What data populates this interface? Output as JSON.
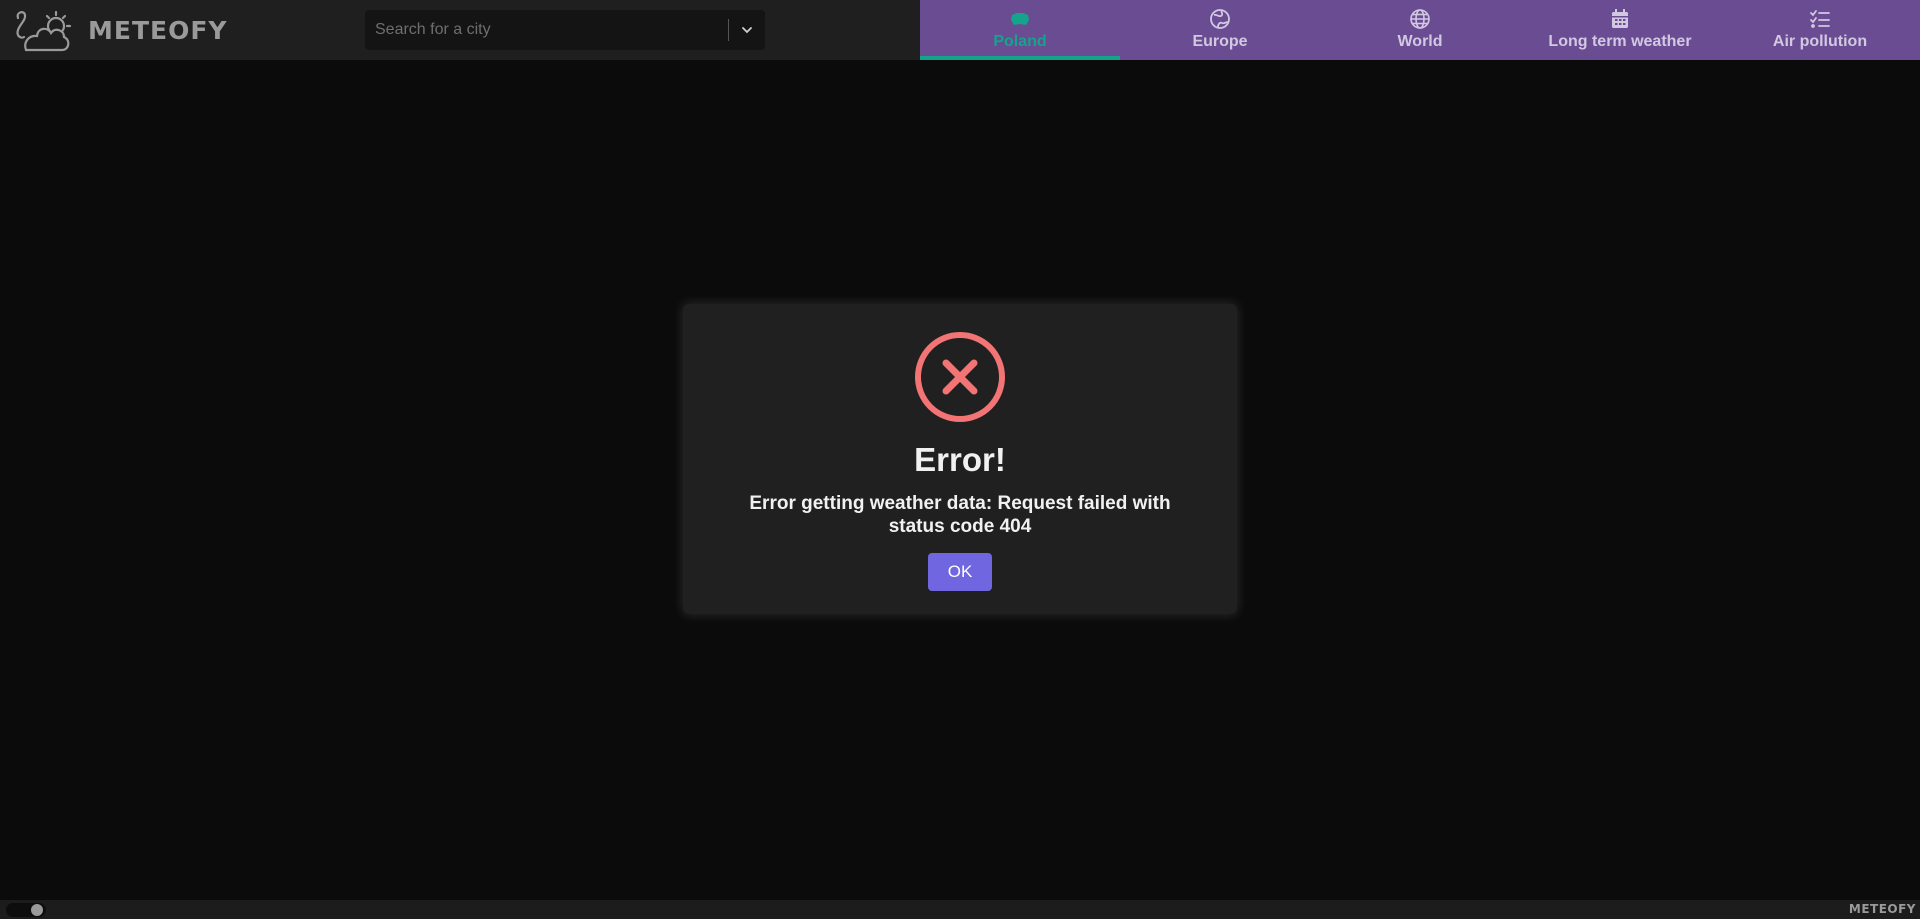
{
  "app": {
    "logo_text": "METEOFY",
    "logo_icon": "cloud-sun-icon"
  },
  "search": {
    "placeholder": "Search for a city",
    "value": "",
    "dropdown_icon": "chevron-down-icon"
  },
  "nav": {
    "tabs": [
      {
        "label": "Poland",
        "icon": "poland-map-icon",
        "active": true
      },
      {
        "label": "Europe",
        "icon": "earth-europe-icon",
        "active": false
      },
      {
        "label": "World",
        "icon": "globe-icon",
        "active": false
      },
      {
        "label": "Long term weather",
        "icon": "calendar-icon",
        "active": false
      },
      {
        "label": "Air pollution",
        "icon": "list-check-icon",
        "active": false
      }
    ]
  },
  "modal": {
    "icon": "error-x-icon",
    "title": "Error!",
    "message": "Error getting weather data: Request failed with status code 404",
    "ok_label": "OK"
  },
  "footer": {
    "logo_text": "METEOFY",
    "theme_toggle": "dark"
  },
  "colors": {
    "nav_background": "#6a4c93",
    "active_tab": "#14a38b",
    "error_icon": "#f27474",
    "ok_button": "#7066e0",
    "page_background": "#0b0b0b"
  }
}
